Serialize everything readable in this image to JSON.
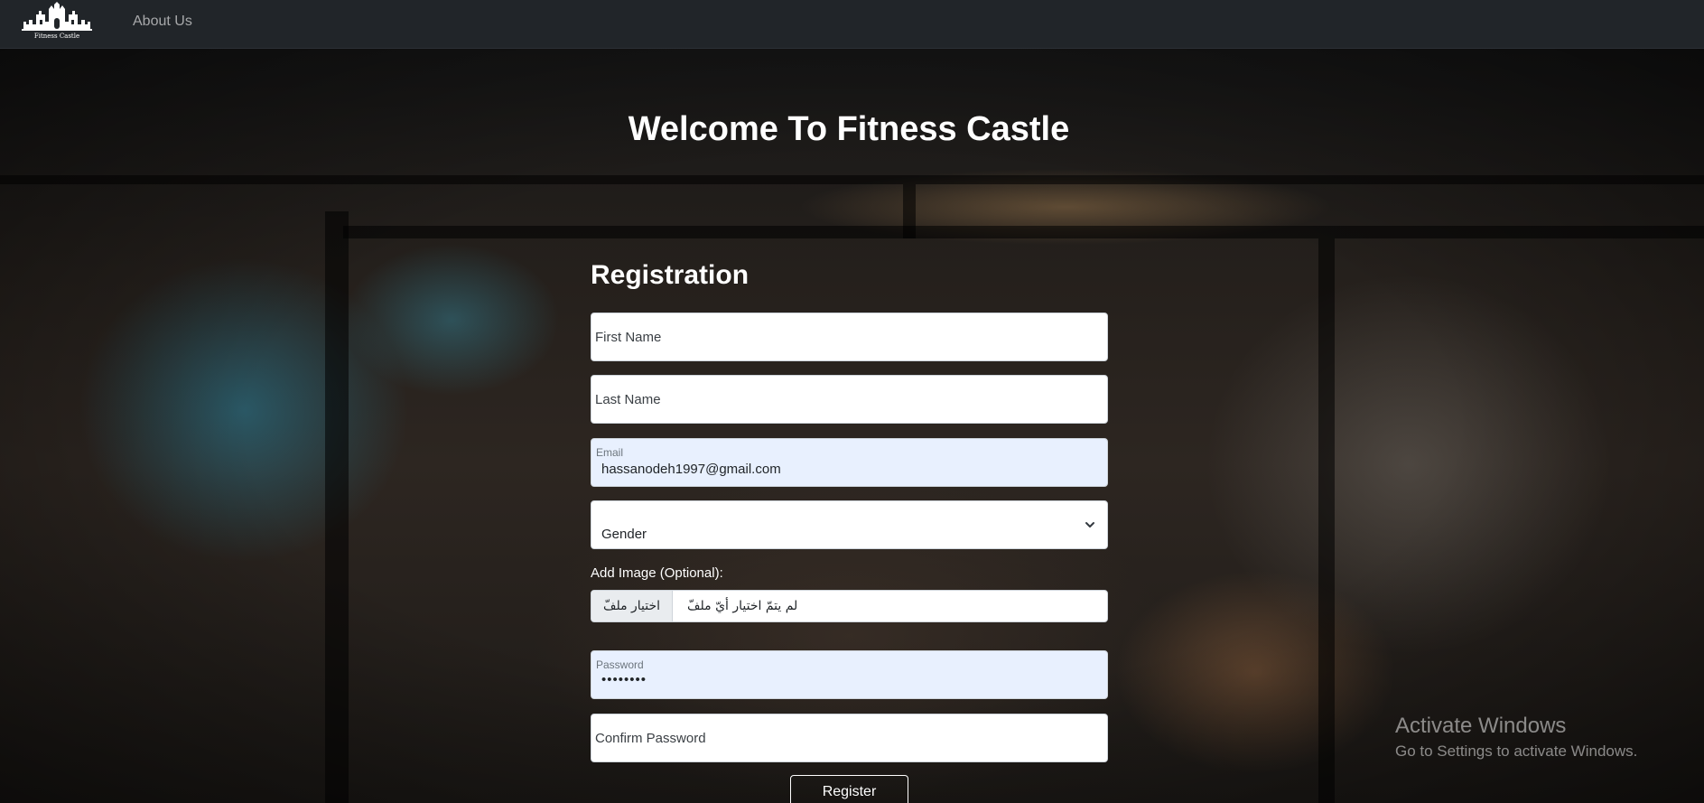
{
  "navbar": {
    "logo_text": "Fitness Castle",
    "links": [
      {
        "label": "About Us"
      }
    ]
  },
  "hero": {
    "title": "Welcome To Fitness Castle"
  },
  "form": {
    "title": "Registration",
    "first_name": {
      "placeholder": "First Name",
      "value": ""
    },
    "last_name": {
      "placeholder": "Last Name",
      "value": ""
    },
    "email": {
      "label": "Email",
      "value": "hassanodeh1997@gmail.com"
    },
    "gender": {
      "selected": "Gender",
      "icon": "chevron-down-icon"
    },
    "image": {
      "label": "Add Image (Optional):",
      "button_label": "اختيار ملفّ",
      "status": "لم يتمّ اختيار أيّ ملفّ"
    },
    "password": {
      "label": "Password",
      "value": "••••••••"
    },
    "confirm_password": {
      "placeholder": "Confirm Password",
      "value": ""
    },
    "submit_label": "Register"
  },
  "watermark": {
    "title": "Activate Windows",
    "subtitle": "Go to Settings to activate Windows."
  },
  "colors": {
    "navbar_bg": "#212529",
    "autofill_bg": "#e8f0fe",
    "text_white": "#ffffff"
  }
}
